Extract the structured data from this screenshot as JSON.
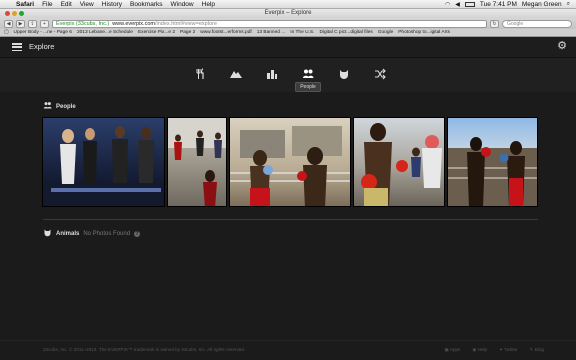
{
  "menubar": {
    "app": "Safari",
    "items": [
      "File",
      "Edit",
      "View",
      "History",
      "Bookmarks",
      "Window",
      "Help"
    ],
    "clock": "Tue 7:41 PM",
    "user": "Megan Green"
  },
  "window": {
    "title": "Everpix – Explore"
  },
  "toolbar": {
    "cert": "Everpix (33cubs, Inc.)",
    "url": "www.everpix.com",
    "url_path": "/index.html#view=explore",
    "search_placeholder": "Google"
  },
  "bookmarks": [
    "Upper Body - ...ne - Page 6",
    "2013 Lebane...e Schedule",
    "Exercise Pix...e 2",
    "Page 2",
    "www.footst...erforms.pdf",
    "13 Banned ...",
    "In The U.S.",
    "Digital C pict...digital files",
    "Google",
    "Photoshop to...igital Arts"
  ],
  "app": {
    "title": "Explore",
    "tooltip": "People",
    "sections": {
      "people": {
        "label": "People"
      },
      "animals": {
        "label": "Animals",
        "empty_text": "No Photos Found"
      }
    }
  },
  "footer": {
    "copyright": "33cubs, Inc. © 2011–2013. The EVERPIX™ trademark is owned by 33cubs, Inc. All rights reserved.",
    "links": [
      "Apps",
      "Help",
      "Twitter",
      "Blog"
    ]
  },
  "colors": {
    "accent": "#e04a2a",
    "background": "#1b1b1b"
  }
}
